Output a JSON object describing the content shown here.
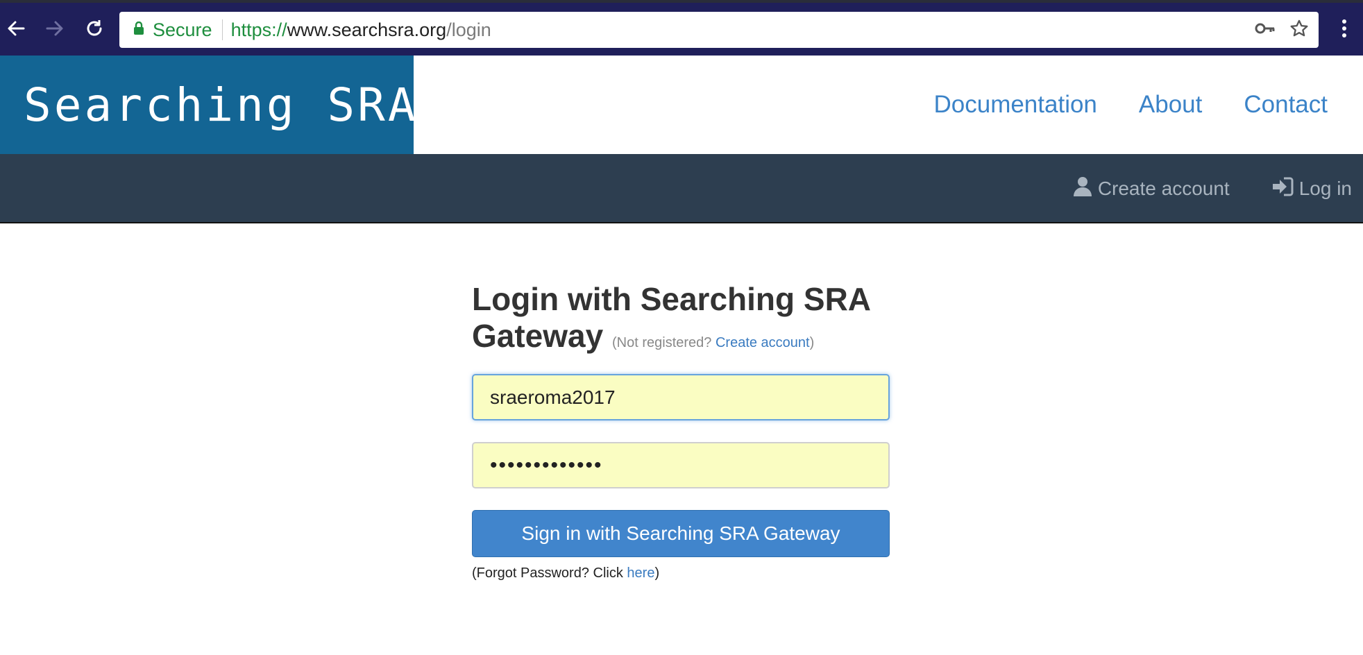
{
  "browser": {
    "secure_label": "Secure",
    "url": {
      "scheme": "https://",
      "host": "www.searchsra.org",
      "path": "/login"
    },
    "icons": [
      "back-arrow-icon",
      "forward-arrow-icon",
      "reload-icon",
      "lock-icon",
      "key-icon",
      "star-icon",
      "menu-dots-icon"
    ],
    "colors": {
      "frame": "#1f1f5a",
      "secure": "#1e8e3e"
    }
  },
  "header": {
    "brand": "Searching SRA",
    "nav": {
      "documentation": "Documentation",
      "about": "About",
      "contact": "Contact"
    },
    "colors": {
      "brand_bg": "#136594",
      "link": "#3b83c8"
    }
  },
  "account_bar": {
    "create_account": "Create account",
    "log_in": "Log in",
    "icons": [
      "user-icon",
      "sign-in-icon"
    ],
    "colors": {
      "bg": "#2d3e50",
      "text": "#a9b4bf"
    }
  },
  "login": {
    "title": "Login with Searching SRA Gateway",
    "hint_prefix": "(Not registered? ",
    "hint_link": "Create account",
    "hint_suffix": ")",
    "username_value": "sraeroma2017",
    "password_value": "•••••••••••••",
    "submit_label": "Sign in with Searching SRA Gateway",
    "forgot_prefix": "(Forgot Password? Click ",
    "forgot_link": "here",
    "forgot_suffix": ")",
    "colors": {
      "button": "#4185cc",
      "autofill": "#fafdc2"
    }
  }
}
